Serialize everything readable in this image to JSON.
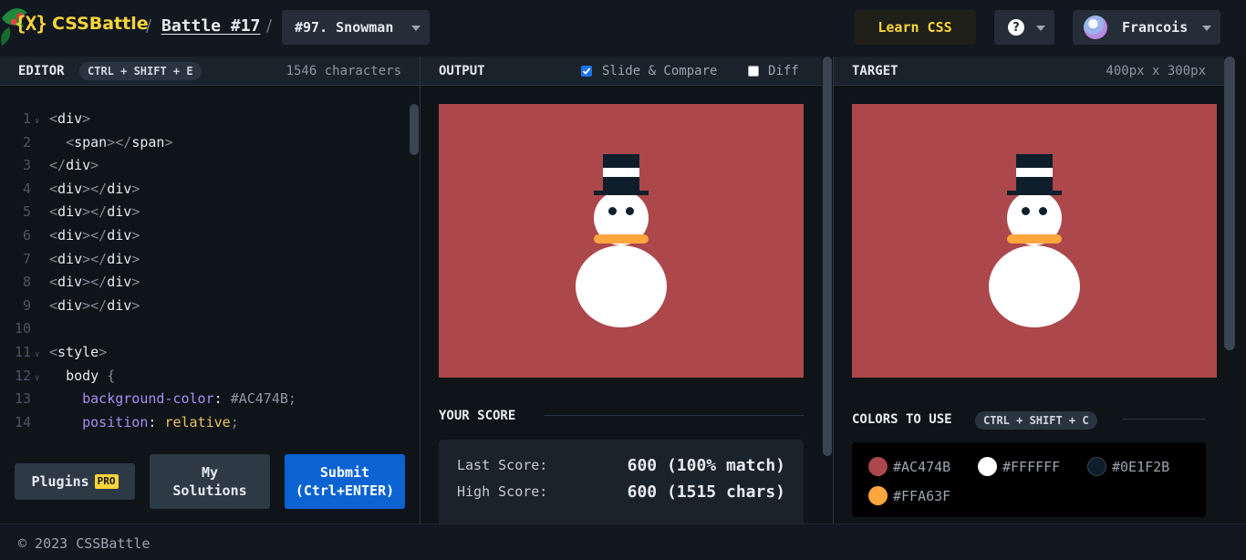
{
  "header": {
    "logo_mark": "{X}",
    "logo_text": "CSSBattle",
    "breadcrumb_sep": "/",
    "battle_link": "Battle #17",
    "challenge_select": "#97. Snowman",
    "learn_label": "Learn CSS",
    "help_symbol": "?",
    "user_name": "Francois"
  },
  "editor": {
    "title": "EDITOR",
    "shortcut": "CTRL + SHIFT + E",
    "char_count": "1546 characters",
    "lines": [
      {
        "n": "1",
        "fold": true,
        "parts": [
          [
            "br",
            "<"
          ],
          [
            "tag",
            "div"
          ],
          [
            "br",
            ">"
          ]
        ]
      },
      {
        "n": "2",
        "fold": false,
        "parts": [
          [
            "sp",
            "  "
          ],
          [
            "br",
            "<"
          ],
          [
            "tag",
            "span"
          ],
          [
            "br",
            "></"
          ],
          [
            "tag",
            "span"
          ],
          [
            "br",
            ">"
          ]
        ]
      },
      {
        "n": "3",
        "fold": false,
        "parts": [
          [
            "br",
            "</"
          ],
          [
            "tag",
            "div"
          ],
          [
            "br",
            ">"
          ]
        ]
      },
      {
        "n": "4",
        "fold": false,
        "parts": [
          [
            "br",
            "<"
          ],
          [
            "tag",
            "div"
          ],
          [
            "br",
            "></"
          ],
          [
            "tag",
            "div"
          ],
          [
            "br",
            ">"
          ]
        ]
      },
      {
        "n": "5",
        "fold": false,
        "parts": [
          [
            "br",
            "<"
          ],
          [
            "tag",
            "div"
          ],
          [
            "br",
            "></"
          ],
          [
            "tag",
            "div"
          ],
          [
            "br",
            ">"
          ]
        ]
      },
      {
        "n": "6",
        "fold": false,
        "parts": [
          [
            "br",
            "<"
          ],
          [
            "tag",
            "div"
          ],
          [
            "br",
            "></"
          ],
          [
            "tag",
            "div"
          ],
          [
            "br",
            ">"
          ]
        ]
      },
      {
        "n": "7",
        "fold": false,
        "parts": [
          [
            "br",
            "<"
          ],
          [
            "tag",
            "div"
          ],
          [
            "br",
            "></"
          ],
          [
            "tag",
            "div"
          ],
          [
            "br",
            ">"
          ]
        ]
      },
      {
        "n": "8",
        "fold": false,
        "parts": [
          [
            "br",
            "<"
          ],
          [
            "tag",
            "div"
          ],
          [
            "br",
            "></"
          ],
          [
            "tag",
            "div"
          ],
          [
            "br",
            ">"
          ]
        ]
      },
      {
        "n": "9",
        "fold": false,
        "parts": [
          [
            "br",
            "<"
          ],
          [
            "tag",
            "div"
          ],
          [
            "br",
            "></"
          ],
          [
            "tag",
            "div"
          ],
          [
            "br",
            ">"
          ]
        ]
      },
      {
        "n": "10",
        "fold": false,
        "parts": []
      },
      {
        "n": "11",
        "fold": true,
        "parts": [
          [
            "br",
            "<"
          ],
          [
            "tag",
            "style"
          ],
          [
            "br",
            ">"
          ]
        ]
      },
      {
        "n": "12",
        "fold": true,
        "parts": [
          [
            "sp",
            "  "
          ],
          [
            "tag",
            "body"
          ],
          [
            "punc",
            " {"
          ]
        ]
      },
      {
        "n": "13",
        "fold": false,
        "parts": [
          [
            "sp",
            "    "
          ],
          [
            "prop",
            "background-color"
          ],
          [
            "tag",
            ": "
          ],
          [
            "hex",
            "#AC474B"
          ],
          [
            "punc",
            ";"
          ]
        ]
      },
      {
        "n": "14",
        "fold": false,
        "parts": [
          [
            "sp",
            "    "
          ],
          [
            "prop",
            "position"
          ],
          [
            "tag",
            ": "
          ],
          [
            "val",
            "relative"
          ],
          [
            "punc",
            ";"
          ]
        ]
      }
    ],
    "plugins_label": "Plugins",
    "pro_label": "PRO",
    "my_solutions_label": "My\nSolutions",
    "submit_label": "Submit\n(Ctrl+ENTER)"
  },
  "output": {
    "title": "OUTPUT",
    "slide_compare_label": "Slide & Compare",
    "slide_compare_checked": true,
    "diff_label": "Diff",
    "diff_checked": false
  },
  "target": {
    "title": "TARGET",
    "size": "400px x 300px"
  },
  "score": {
    "title": "YOUR SCORE",
    "last_label": "Last Score:",
    "last_value": "600 (100% match)",
    "high_label": "High Score:",
    "high_value": "600 (1515 chars)"
  },
  "colors": {
    "title": "COLORS TO USE",
    "shortcut": "CTRL + SHIFT + C",
    "swatches": [
      {
        "hex": "#AC474B",
        "label": "#AC474B"
      },
      {
        "hex": "#FFFFFF",
        "label": "#FFFFFF"
      },
      {
        "hex": "#0E1F2B",
        "label": "#0E1F2B"
      },
      {
        "hex": "#FFA63F",
        "label": "#FFA63F"
      }
    ]
  },
  "footer": {
    "copyright": "© 2023 CSSBattle"
  }
}
